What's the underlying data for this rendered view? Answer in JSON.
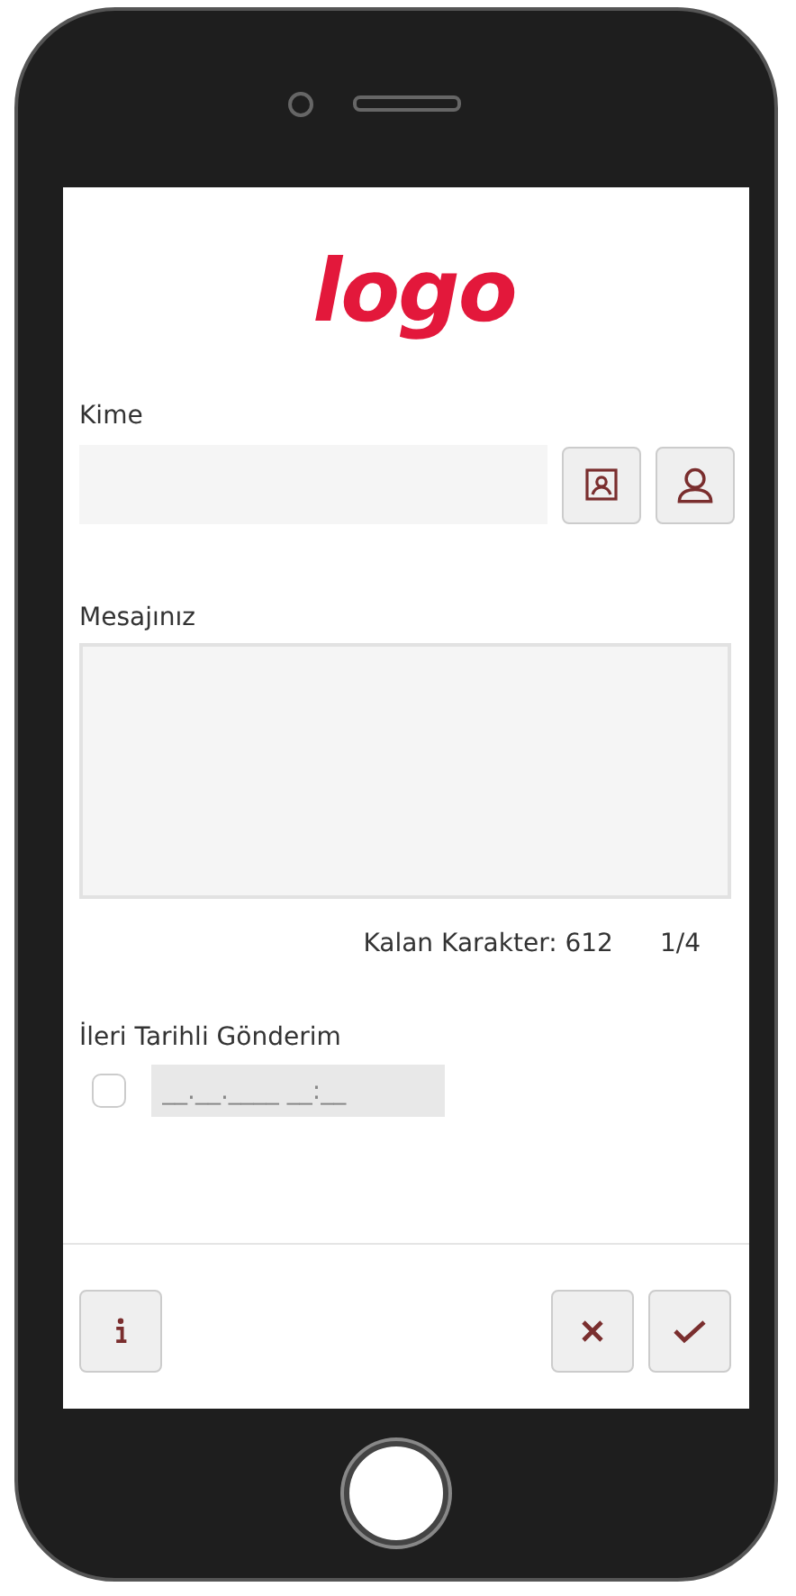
{
  "logo": "logo",
  "recipient": {
    "label": "Kime"
  },
  "message": {
    "label": "Mesajınız"
  },
  "counter": {
    "label": "Kalan Karakter:",
    "value": "612",
    "pages": "1/4"
  },
  "scheduled": {
    "label": "İleri Tarihli Gönderim",
    "checked": false,
    "placeholder": "__.__.____ __:__"
  }
}
